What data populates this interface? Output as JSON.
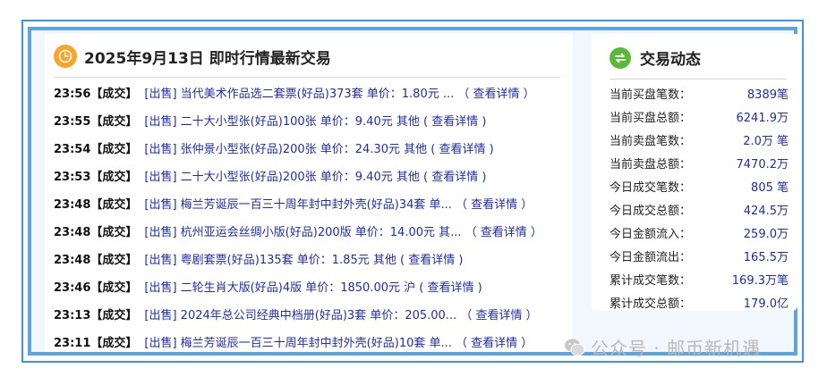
{
  "left": {
    "title": "2025年9月13日 即时行情最新交易",
    "trades": [
      {
        "time": "23:56",
        "status": "【成交】",
        "text": "[出售] 当代美术作品选二套票(好品)373套 单价：1.80元 ...",
        "detail": "（ 查看详情 ）"
      },
      {
        "time": "23:55",
        "status": "【成交】",
        "text": "[出售] 二十大小型张(好品)100张 单价：9.40元 其他",
        "detail": "( 查看详情 )"
      },
      {
        "time": "23:54",
        "status": "【成交】",
        "text": "[出售] 张仲景小型张(好品)200张 单价：24.30元 其他",
        "detail": "( 查看详情 )"
      },
      {
        "time": "23:53",
        "status": "【成交】",
        "text": "[出售] 二十大小型张(好品)200张 单价：9.40元 其他",
        "detail": "( 查看详情 )"
      },
      {
        "time": "23:48",
        "status": "【成交】",
        "text": "[出售] 梅兰芳诞辰一百三十周年封中封外壳(好品)34套 单...",
        "detail": "（ 查看详情 ）"
      },
      {
        "time": "23:48",
        "status": "【成交】",
        "text": "[出售] 杭州亚运会丝绸小版(好品)200版 单价：14.00元 其...",
        "detail": "（ 查看详情 ）"
      },
      {
        "time": "23:48",
        "status": "【成交】",
        "text": "[出售] 粤剧套票(好品)135套 单价：1.85元 其他",
        "detail": "( 查看详情 )"
      },
      {
        "time": "23:46",
        "status": "【成交】",
        "text": "[出售] 二轮生肖大版(好品)4版 单价：1850.00元 沪",
        "detail": "( 查看详情 )"
      },
      {
        "time": "23:13",
        "status": "【成交】",
        "text": "[出售] 2024年总公司经典中档册(好品)3套 单价：205.00...",
        "detail": "（ 查看详情 ）"
      },
      {
        "time": "23:11",
        "status": "【成交】",
        "text": "[出售] 梅兰芳诞辰一百三十周年封中封外壳(好品)10套 单...",
        "detail": "（ 查看详情 ）"
      }
    ]
  },
  "right": {
    "title": "交易动态",
    "stats": [
      {
        "label": "当前买盘笔数：",
        "value": "8389笔"
      },
      {
        "label": "当前买盘总额：",
        "value": "6241.9万"
      },
      {
        "label": "当前卖盘笔数：",
        "value": "2.0万 笔"
      },
      {
        "label": "当前卖盘总额：",
        "value": "7470.2万"
      },
      {
        "label": "今日成交笔数：",
        "value": "805 笔"
      },
      {
        "label": "今日成交总额：",
        "value": "424.5万"
      },
      {
        "label": "今日金额流入：",
        "value": "259.0万"
      },
      {
        "label": "今日金额流出：",
        "value": "165.5万"
      },
      {
        "label": "累计成交笔数：",
        "value": "169.3万笔"
      },
      {
        "label": "累计成交总额：",
        "value": "179.0亿"
      }
    ]
  },
  "watermark": {
    "text": "公众号 · 邮币新机遇"
  },
  "icons": {
    "header_left": "clock-icon",
    "header_right": "exchange-icon",
    "watermark": "wechat-icon"
  },
  "colors": {
    "frame": "#3f95d8",
    "link": "#1f2ea8",
    "clock": "#f8a52c",
    "exchange": "#5bb93a"
  }
}
